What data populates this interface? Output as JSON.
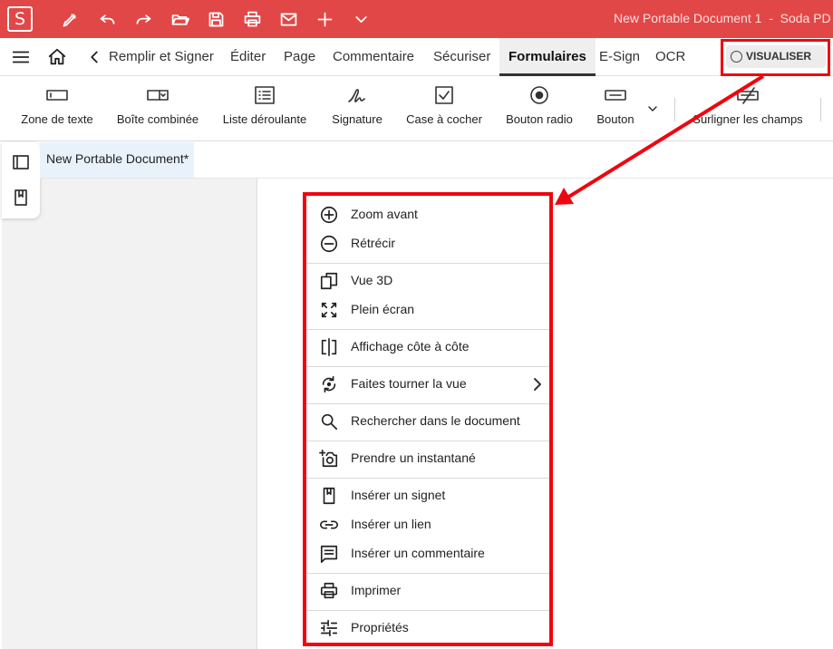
{
  "app": {
    "logo_letter": "S",
    "window_title": "New Portable Document 1  -  Soda PD",
    "brand_color": "#e24747",
    "highlight_color": "#f0050e"
  },
  "quick_access": [
    {
      "name": "pen-icon"
    },
    {
      "name": "undo-icon"
    },
    {
      "name": "redo-icon"
    },
    {
      "name": "open-folder-icon"
    },
    {
      "name": "save-icon"
    },
    {
      "name": "print-icon"
    },
    {
      "name": "mail-icon"
    },
    {
      "name": "plus-icon"
    },
    {
      "name": "chevron-down-icon"
    }
  ],
  "menubar": {
    "tabs": [
      {
        "label": "Remplir et Signer"
      },
      {
        "label": "Éditer"
      },
      {
        "label": "Page"
      },
      {
        "label": "Commentaire"
      },
      {
        "label": "Sécuriser"
      },
      {
        "label": "Formulaires",
        "active": true
      },
      {
        "label": "E-Sign"
      },
      {
        "label": "OCR"
      }
    ],
    "visualize_label": "VISUALISER"
  },
  "ribbon": {
    "items": [
      {
        "label": "Zone de texte",
        "icon": "text-field-icon"
      },
      {
        "label": "Boîte combinée",
        "icon": "combo-box-icon"
      },
      {
        "label": "Liste déroulante",
        "icon": "list-box-icon"
      },
      {
        "label": "Signature",
        "icon": "signature-icon"
      },
      {
        "label": "Case à cocher",
        "icon": "checkbox-icon"
      },
      {
        "label": "Bouton radio",
        "icon": "radio-button-icon"
      },
      {
        "label": "Bouton",
        "icon": "button-icon"
      },
      {
        "label": "Surligner les champs",
        "icon": "highlight-fields-icon"
      }
    ]
  },
  "document": {
    "tab_title": "New Portable Document*"
  },
  "context_menu": {
    "items": [
      {
        "label": "Zoom avant",
        "icon": "zoom-in-icon"
      },
      {
        "label": "Rétrécir",
        "icon": "zoom-out-icon"
      },
      {
        "label": "Vue 3D",
        "icon": "view-3d-icon"
      },
      {
        "label": "Plein écran",
        "icon": "fullscreen-icon"
      },
      {
        "label": "Affichage côte à côte",
        "icon": "side-by-side-icon"
      },
      {
        "label": "Faites tourner la vue",
        "icon": "rotate-view-icon",
        "submenu": true
      },
      {
        "label": "Rechercher dans le document",
        "icon": "search-icon"
      },
      {
        "label": "Prendre un instantané",
        "icon": "snapshot-icon"
      },
      {
        "label": "Insérer un signet",
        "icon": "bookmark-icon"
      },
      {
        "label": "Insérer un lien",
        "icon": "link-icon"
      },
      {
        "label": "Insérer un commentaire",
        "icon": "comment-icon"
      },
      {
        "label": "Imprimer",
        "icon": "print-icon"
      },
      {
        "label": "Propriétés",
        "icon": "properties-icon"
      }
    ]
  }
}
